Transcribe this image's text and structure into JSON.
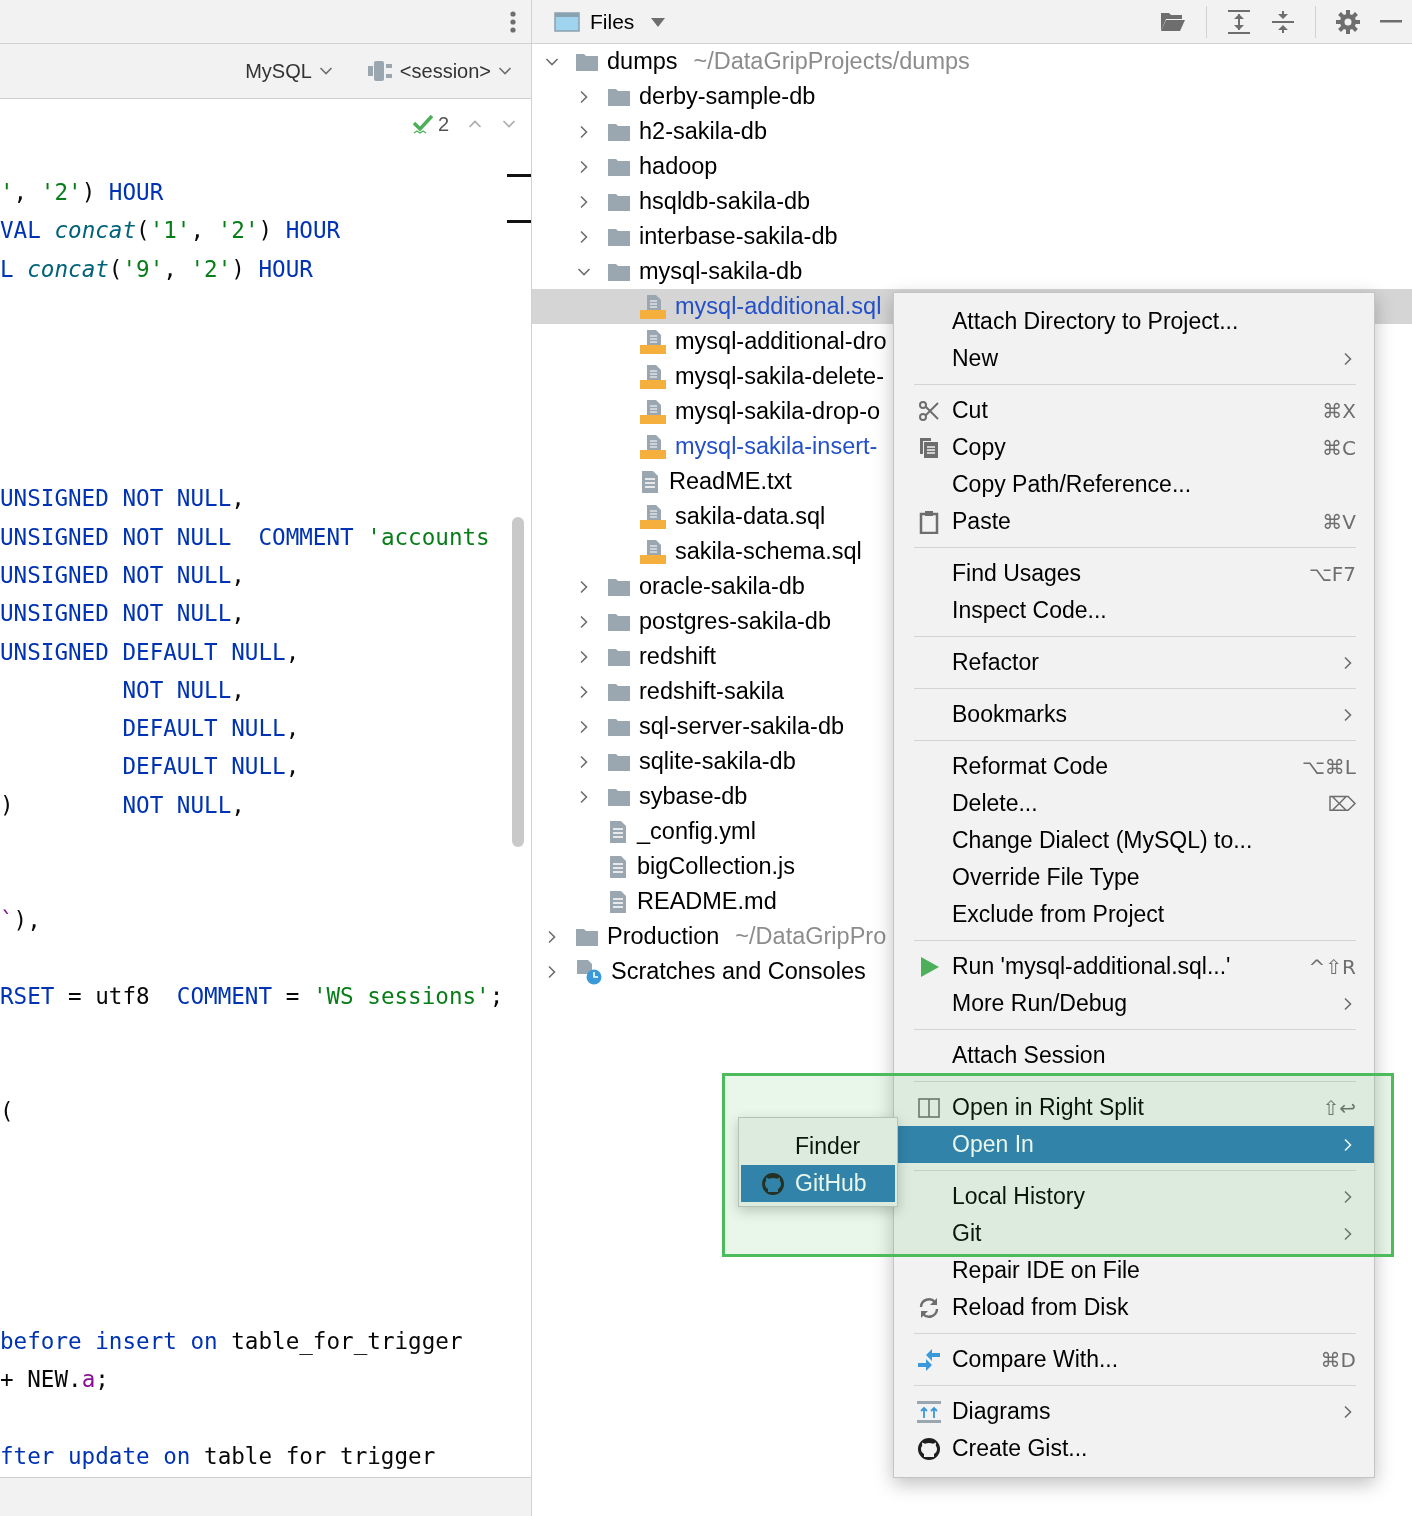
{
  "editor": {
    "dialect": "MySQL",
    "session": "<session>",
    "problem_count": "2",
    "lines": [
      {
        "kind": "code",
        "tokens": [
          {
            "kind": "string",
            "text": "'"
          },
          {
            "kind": "plain",
            "text": ", "
          },
          {
            "kind": "string",
            "text": "'2'"
          },
          {
            "kind": "plain",
            "text": ") "
          },
          {
            "kind": "keyword",
            "text": "HOUR"
          }
        ]
      },
      {
        "kind": "code",
        "tokens": [
          {
            "kind": "keyword",
            "text": "VAL "
          },
          {
            "kind": "function",
            "text": "concat"
          },
          {
            "kind": "plain",
            "text": "("
          },
          {
            "kind": "string",
            "text": "'1'"
          },
          {
            "kind": "plain",
            "text": ", "
          },
          {
            "kind": "string",
            "text": "'2'"
          },
          {
            "kind": "plain",
            "text": ") "
          },
          {
            "kind": "keyword",
            "text": "HOUR"
          }
        ]
      },
      {
        "kind": "code",
        "tokens": [
          {
            "kind": "keyword",
            "text": "L "
          },
          {
            "kind": "function",
            "text": "concat"
          },
          {
            "kind": "plain",
            "text": "("
          },
          {
            "kind": "string",
            "text": "'9'"
          },
          {
            "kind": "plain",
            "text": ", "
          },
          {
            "kind": "string",
            "text": "'2'"
          },
          {
            "kind": "plain",
            "text": ") "
          },
          {
            "kind": "keyword",
            "text": "HOUR"
          }
        ]
      },
      {
        "kind": "blank"
      },
      {
        "kind": "blank"
      },
      {
        "kind": "blank"
      },
      {
        "kind": "blank"
      },
      {
        "kind": "blank"
      },
      {
        "kind": "code",
        "tokens": [
          {
            "kind": "keyword",
            "text": "UNSIGNED NOT NULL"
          },
          {
            "kind": "plain",
            "text": ","
          }
        ]
      },
      {
        "kind": "code",
        "tokens": [
          {
            "kind": "keyword",
            "text": "UNSIGNED NOT NULL  COMMENT "
          },
          {
            "kind": "string",
            "text": "'accounts"
          }
        ]
      },
      {
        "kind": "code",
        "tokens": [
          {
            "kind": "keyword",
            "text": "UNSIGNED NOT NULL"
          },
          {
            "kind": "plain",
            "text": ","
          }
        ]
      },
      {
        "kind": "code",
        "tokens": [
          {
            "kind": "keyword",
            "text": "UNSIGNED NOT NULL"
          },
          {
            "kind": "plain",
            "text": ","
          }
        ]
      },
      {
        "kind": "code",
        "tokens": [
          {
            "kind": "keyword",
            "text": "UNSIGNED DEFAULT NULL"
          },
          {
            "kind": "plain",
            "text": ","
          }
        ]
      },
      {
        "kind": "code",
        "tokens": [
          {
            "kind": "keyword",
            "text": "         NOT NULL"
          },
          {
            "kind": "plain",
            "text": ","
          }
        ]
      },
      {
        "kind": "code",
        "tokens": [
          {
            "kind": "keyword",
            "text": "         DEFAULT NULL"
          },
          {
            "kind": "plain",
            "text": ","
          }
        ]
      },
      {
        "kind": "code",
        "tokens": [
          {
            "kind": "keyword",
            "text": "         DEFAULT NULL"
          },
          {
            "kind": "plain",
            "text": ","
          }
        ]
      },
      {
        "kind": "code",
        "tokens": [
          {
            "kind": "plain",
            "text": ")        "
          },
          {
            "kind": "keyword",
            "text": "NOT NULL"
          },
          {
            "kind": "plain",
            "text": ","
          }
        ]
      },
      {
        "kind": "blank"
      },
      {
        "kind": "blank"
      },
      {
        "kind": "code",
        "tokens": [
          {
            "kind": "field",
            "text": "`"
          },
          {
            "kind": "plain",
            "text": "),"
          }
        ]
      },
      {
        "kind": "blank"
      },
      {
        "kind": "code",
        "tokens": [
          {
            "kind": "keyword",
            "text": "RSET"
          },
          {
            "kind": "plain",
            "text": " = utf8  "
          },
          {
            "kind": "keyword",
            "text": "COMMENT"
          },
          {
            "kind": "plain",
            "text": " = "
          },
          {
            "kind": "string",
            "text": "'WS sessions'"
          },
          {
            "kind": "plain",
            "text": ";"
          }
        ]
      },
      {
        "kind": "blank"
      },
      {
        "kind": "blank"
      },
      {
        "kind": "code",
        "tokens": [
          {
            "kind": "plain",
            "text": "("
          }
        ]
      },
      {
        "kind": "blank"
      },
      {
        "kind": "blank"
      },
      {
        "kind": "blank"
      },
      {
        "kind": "blank"
      },
      {
        "kind": "blank"
      },
      {
        "kind": "code",
        "tokens": [
          {
            "kind": "keyword",
            "text": "before insert on"
          },
          {
            "kind": "plain",
            "text": " table_for_trigger"
          }
        ]
      },
      {
        "kind": "code",
        "tokens": [
          {
            "kind": "plain",
            "text": "+ NEW."
          },
          {
            "kind": "field",
            "text": "a"
          },
          {
            "kind": "plain",
            "text": ";"
          }
        ]
      },
      {
        "kind": "blank"
      },
      {
        "kind": "code",
        "tokens": [
          {
            "kind": "keyword",
            "text": "fter update on"
          },
          {
            "kind": "plain",
            "text": " table for trigger"
          }
        ]
      }
    ]
  },
  "files": {
    "title": "Files",
    "tree": [
      {
        "kind": "folder",
        "label": "dumps",
        "hint": "~/DataGripProjects/dumps",
        "expanded": true,
        "selected": false,
        "children": [
          {
            "kind": "folder",
            "label": "derby-sample-db",
            "expanded": false,
            "selected": false
          },
          {
            "kind": "folder",
            "label": "h2-sakila-db",
            "expanded": false,
            "selected": false
          },
          {
            "kind": "folder",
            "label": "hadoop",
            "expanded": false,
            "selected": false
          },
          {
            "kind": "folder",
            "label": "hsqldb-sakila-db",
            "expanded": false,
            "selected": false
          },
          {
            "kind": "folder",
            "label": "interbase-sakila-db",
            "expanded": false,
            "selected": false
          },
          {
            "kind": "folder",
            "label": "mysql-sakila-db",
            "expanded": true,
            "selected": false,
            "children": [
              {
                "kind": "sql_file",
                "label": "mysql-additional.sql",
                "selected": true,
                "modified": true
              },
              {
                "kind": "sql_file",
                "label": "mysql-additional-dro",
                "selected": false,
                "modified": false
              },
              {
                "kind": "sql_file",
                "label": "mysql-sakila-delete-",
                "selected": false,
                "modified": false
              },
              {
                "kind": "sql_file",
                "label": "mysql-sakila-drop-o",
                "selected": false,
                "modified": false
              },
              {
                "kind": "sql_file",
                "label": "mysql-sakila-insert-",
                "selected": false,
                "modified": true
              },
              {
                "kind": "text_file",
                "label": "ReadME.txt",
                "selected": false,
                "modified": false
              },
              {
                "kind": "sql_file",
                "label": "sakila-data.sql",
                "selected": false,
                "modified": false
              },
              {
                "kind": "sql_file",
                "label": "sakila-schema.sql",
                "selected": false,
                "modified": false
              }
            ]
          },
          {
            "kind": "folder",
            "label": "oracle-sakila-db",
            "expanded": false,
            "selected": false
          },
          {
            "kind": "folder",
            "label": "postgres-sakila-db",
            "expanded": false,
            "selected": false
          },
          {
            "kind": "folder",
            "label": "redshift",
            "expanded": false,
            "selected": false
          },
          {
            "kind": "folder",
            "label": "redshift-sakila",
            "expanded": false,
            "selected": false
          },
          {
            "kind": "folder",
            "label": "sql-server-sakila-db",
            "expanded": false,
            "selected": false
          },
          {
            "kind": "folder",
            "label": "sqlite-sakila-db",
            "expanded": false,
            "selected": false
          },
          {
            "kind": "folder",
            "label": "sybase-db",
            "expanded": false,
            "selected": false
          },
          {
            "kind": "text_file",
            "label": "_config.yml",
            "selected": false
          },
          {
            "kind": "text_file",
            "label": "bigCollection.js",
            "selected": false
          },
          {
            "kind": "text_file",
            "label": "README.md",
            "selected": false
          }
        ]
      },
      {
        "kind": "folder",
        "label": "Production",
        "hint": "~/DataGripPro",
        "expanded": false,
        "selected": false
      },
      {
        "kind": "scratches",
        "label": "Scratches and Consoles",
        "expanded": false,
        "selected": false
      }
    ]
  },
  "context_menu": {
    "items": [
      {
        "kind": "item",
        "label": "Attach Directory to Project...",
        "submenu": false,
        "selected": false
      },
      {
        "kind": "item",
        "label": "New",
        "submenu": true,
        "selected": false
      },
      {
        "kind": "separator"
      },
      {
        "kind": "item",
        "label": "Cut",
        "shortcut": "⌘X",
        "submenu": false,
        "selected": false
      },
      {
        "kind": "item",
        "label": "Copy",
        "shortcut": "⌘C",
        "submenu": false,
        "selected": false
      },
      {
        "kind": "item",
        "label": "Copy Path/Reference...",
        "submenu": false,
        "selected": false
      },
      {
        "kind": "item",
        "label": "Paste",
        "shortcut": "⌘V",
        "submenu": false,
        "selected": false
      },
      {
        "kind": "separator"
      },
      {
        "kind": "item",
        "label": "Find Usages",
        "shortcut": "⌥F7",
        "submenu": false,
        "selected": false
      },
      {
        "kind": "item",
        "label": "Inspect Code...",
        "submenu": false,
        "selected": false
      },
      {
        "kind": "separator"
      },
      {
        "kind": "item",
        "label": "Refactor",
        "submenu": true,
        "selected": false
      },
      {
        "kind": "separator"
      },
      {
        "kind": "item",
        "label": "Bookmarks",
        "submenu": true,
        "selected": false
      },
      {
        "kind": "separator"
      },
      {
        "kind": "item",
        "label": "Reformat Code",
        "shortcut": "⌥⌘L",
        "submenu": false,
        "selected": false
      },
      {
        "kind": "item",
        "label": "Delete...",
        "shortcut": "⌦",
        "submenu": false,
        "selected": false
      },
      {
        "kind": "item",
        "label": "Change Dialect (MySQL) to...",
        "submenu": false,
        "selected": false
      },
      {
        "kind": "item",
        "label": "Override File Type",
        "submenu": false,
        "selected": false
      },
      {
        "kind": "item",
        "label": "Exclude from Project",
        "submenu": false,
        "selected": false
      },
      {
        "kind": "separator"
      },
      {
        "kind": "item",
        "label": "Run 'mysql-additional.sql...'",
        "shortcut": "^⇧R",
        "submenu": false,
        "selected": false
      },
      {
        "kind": "item",
        "label": "More Run/Debug",
        "submenu": true,
        "selected": false
      },
      {
        "kind": "separator"
      },
      {
        "kind": "item",
        "label": "Attach Session",
        "submenu": false,
        "selected": false
      },
      {
        "kind": "separator"
      },
      {
        "kind": "item",
        "label": "Open in Right Split",
        "shortcut": "⇧↩",
        "submenu": false,
        "selected": false
      },
      {
        "kind": "item",
        "label": "Open In",
        "submenu": true,
        "selected": true
      },
      {
        "kind": "separator"
      },
      {
        "kind": "item",
        "label": "Local History",
        "submenu": true,
        "selected": false
      },
      {
        "kind": "item",
        "label": "Git",
        "submenu": true,
        "selected": false
      },
      {
        "kind": "item",
        "label": "Repair IDE on File",
        "submenu": false,
        "selected": false
      },
      {
        "kind": "item",
        "label": "Reload from Disk",
        "submenu": false,
        "selected": false
      },
      {
        "kind": "separator"
      },
      {
        "kind": "item",
        "label": "Compare With...",
        "shortcut": "⌘D",
        "submenu": false,
        "selected": false
      },
      {
        "kind": "separator"
      },
      {
        "kind": "item",
        "label": "Diagrams",
        "submenu": true,
        "selected": false
      },
      {
        "kind": "item",
        "label": "Create Gist...",
        "submenu": false,
        "selected": false
      }
    ]
  },
  "submenu": {
    "items": [
      {
        "label": "Finder",
        "selected": false
      },
      {
        "label": "GitHub",
        "selected": true
      }
    ]
  }
}
